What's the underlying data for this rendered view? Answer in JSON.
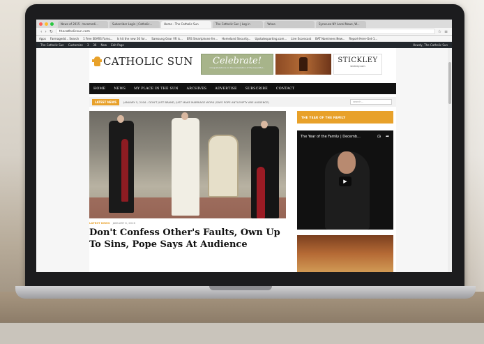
{
  "browser": {
    "tabs": [
      {
        "label": "News of 2015 - tecomedi..."
      },
      {
        "label": "Subscriber Login | Catholic..."
      },
      {
        "label": "Home - The Catholic Sun"
      },
      {
        "label": "The Catholic Sun | Log in"
      },
      {
        "label": "Yahoo"
      },
      {
        "label": "Syracuse NY Local News, W..."
      }
    ],
    "url": "thecatholicsun.com",
    "bookmarks": [
      "Apps",
      "Farmagedd... Search",
      "1 Free SEARS Famo...",
      "Is hit the new 30 for...",
      "Samsung Gear VR is...",
      "ERS Smartphone fre...",
      "Homeland Security...",
      "Upstatesporting.com...",
      "Live Scorecast",
      "BAT Nominees New...",
      "Report-Here-Get-1..."
    ],
    "wp_toolbar": {
      "site": "The Catholic Sun",
      "items": [
        "Customize",
        "3",
        "36",
        "New",
        "Edit Page"
      ],
      "greeting": "Howdy, The Catholic Sun"
    }
  },
  "site": {
    "logo_text": "CATHOLIC SUN",
    "ads": {
      "celebrate_title": "Celebrate!",
      "celebrate_sub": "Congratulations on the completion of the beautiful...",
      "stickley_title": "STICKLEY",
      "stickley_sub": "stickley.com"
    },
    "nav": [
      "HOME",
      "NEWS",
      "MY PLACE IN THE SUN",
      "ARCHIVES",
      "ADVERTISE",
      "SUBSCRIBE",
      "CONTACT"
    ],
    "ticker_label": "LATEST NEWS",
    "ticker_text": "JANUARY 5, 2016 - DON'T JUST BRAND, JUST MAKE MARRIAGE WORK (SAYS POPE ANTI-EMPTY ARE AUDIENCE)",
    "search_placeholder": "search...",
    "article": {
      "category": "LATEST NEWS",
      "date": "JANUARY 6, 2016",
      "headline": "Don't Confess Other's Faults, Own Up To Sins, Pope Says At Audience"
    },
    "sidebar": {
      "banner": "THE YEAR OF THE FAMILY",
      "video_title": "The Year of the Family | Decemb..."
    }
  },
  "colors": {
    "accent": "#e8a12a",
    "nav_bg": "#111111"
  }
}
